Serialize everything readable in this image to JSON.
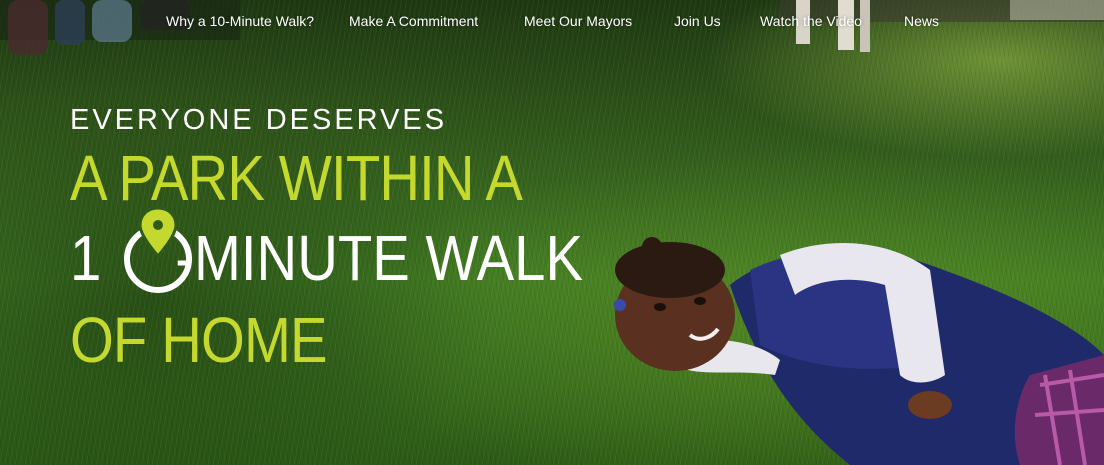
{
  "nav": {
    "items": [
      {
        "label": "Why a 10-Minute Walk?"
      },
      {
        "label": "Make A Commitment"
      },
      {
        "label": "Meet Our Mayors"
      },
      {
        "label": "Join Us"
      },
      {
        "label": "Watch the Video"
      },
      {
        "label": "News"
      }
    ]
  },
  "hero": {
    "eyebrow": "EVERYONE DESERVES",
    "line1": "A PARK WITHIN A",
    "line2_start": "1",
    "line2_end": "-MINUTE WALK",
    "line3": "OF HOME",
    "logo_icon": "location-pin-icon",
    "accent_color": "#c4d82e",
    "text_color": "#ffffff"
  }
}
